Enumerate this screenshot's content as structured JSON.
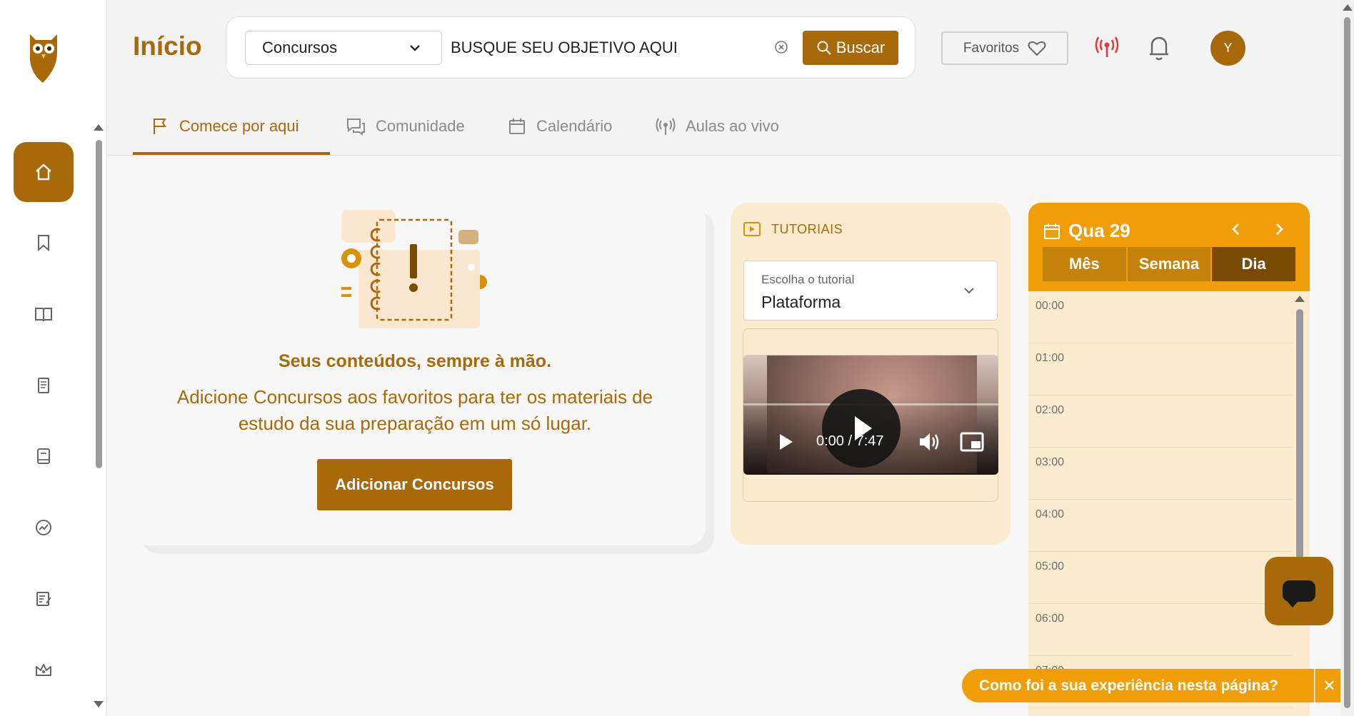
{
  "page": {
    "title": "Início"
  },
  "search": {
    "category_value": "Concursos",
    "placeholder": "BUSQUE SEU OBJETIVO AQUI",
    "button_label": "Buscar"
  },
  "header": {
    "favorites_label": "Favoritos",
    "avatar_initial": "Y"
  },
  "tabs": [
    {
      "label": "Comece por aqui",
      "icon": "flag-icon",
      "active": true
    },
    {
      "label": "Comunidade",
      "icon": "chat-icon",
      "active": false
    },
    {
      "label": "Calendário",
      "icon": "calendar-icon",
      "active": false
    },
    {
      "label": "Aulas ao vivo",
      "icon": "broadcast-icon",
      "active": false
    }
  ],
  "sidebar": {
    "items": [
      {
        "icon": "home-icon",
        "active": true
      },
      {
        "icon": "bookmark-icon",
        "active": false
      },
      {
        "icon": "book-open-icon",
        "active": false
      },
      {
        "icon": "document-icon",
        "active": false
      },
      {
        "icon": "notebook-icon",
        "active": false
      },
      {
        "icon": "performance-icon",
        "active": false
      },
      {
        "icon": "edit-list-icon",
        "active": false
      },
      {
        "icon": "crown-icon",
        "active": false
      }
    ]
  },
  "favorites_empty": {
    "heading": "Seus conteúdos, sempre à mão.",
    "text": "Adicione Concursos aos favoritos para ter os materiais de estudo da sua preparação em um só lugar.",
    "button_label": "Adicionar Concursos"
  },
  "tutorials": {
    "section_label": "TUTORIAIS",
    "select_label": "Escolha o tutorial",
    "select_value": "Plataforma",
    "video": {
      "current_time": "0:00",
      "separator": "/",
      "duration": "7:47"
    }
  },
  "calendar": {
    "date_label": "Qua 29",
    "view_tabs": [
      {
        "label": "Mês",
        "active": false
      },
      {
        "label": "Semana",
        "active": false
      },
      {
        "label": "Dia",
        "active": true
      }
    ],
    "hours": [
      "00:00",
      "01:00",
      "02:00",
      "03:00",
      "04:00",
      "05:00",
      "06:00",
      "07:00"
    ]
  },
  "feedback": {
    "prompt": "Como foi a sua experiência nesta página?",
    "close_label": "✕"
  },
  "colors": {
    "brand": "#a8690a",
    "accent": "#ef9e0a",
    "soft": "#fdebd0",
    "live": "#e03a3a"
  }
}
